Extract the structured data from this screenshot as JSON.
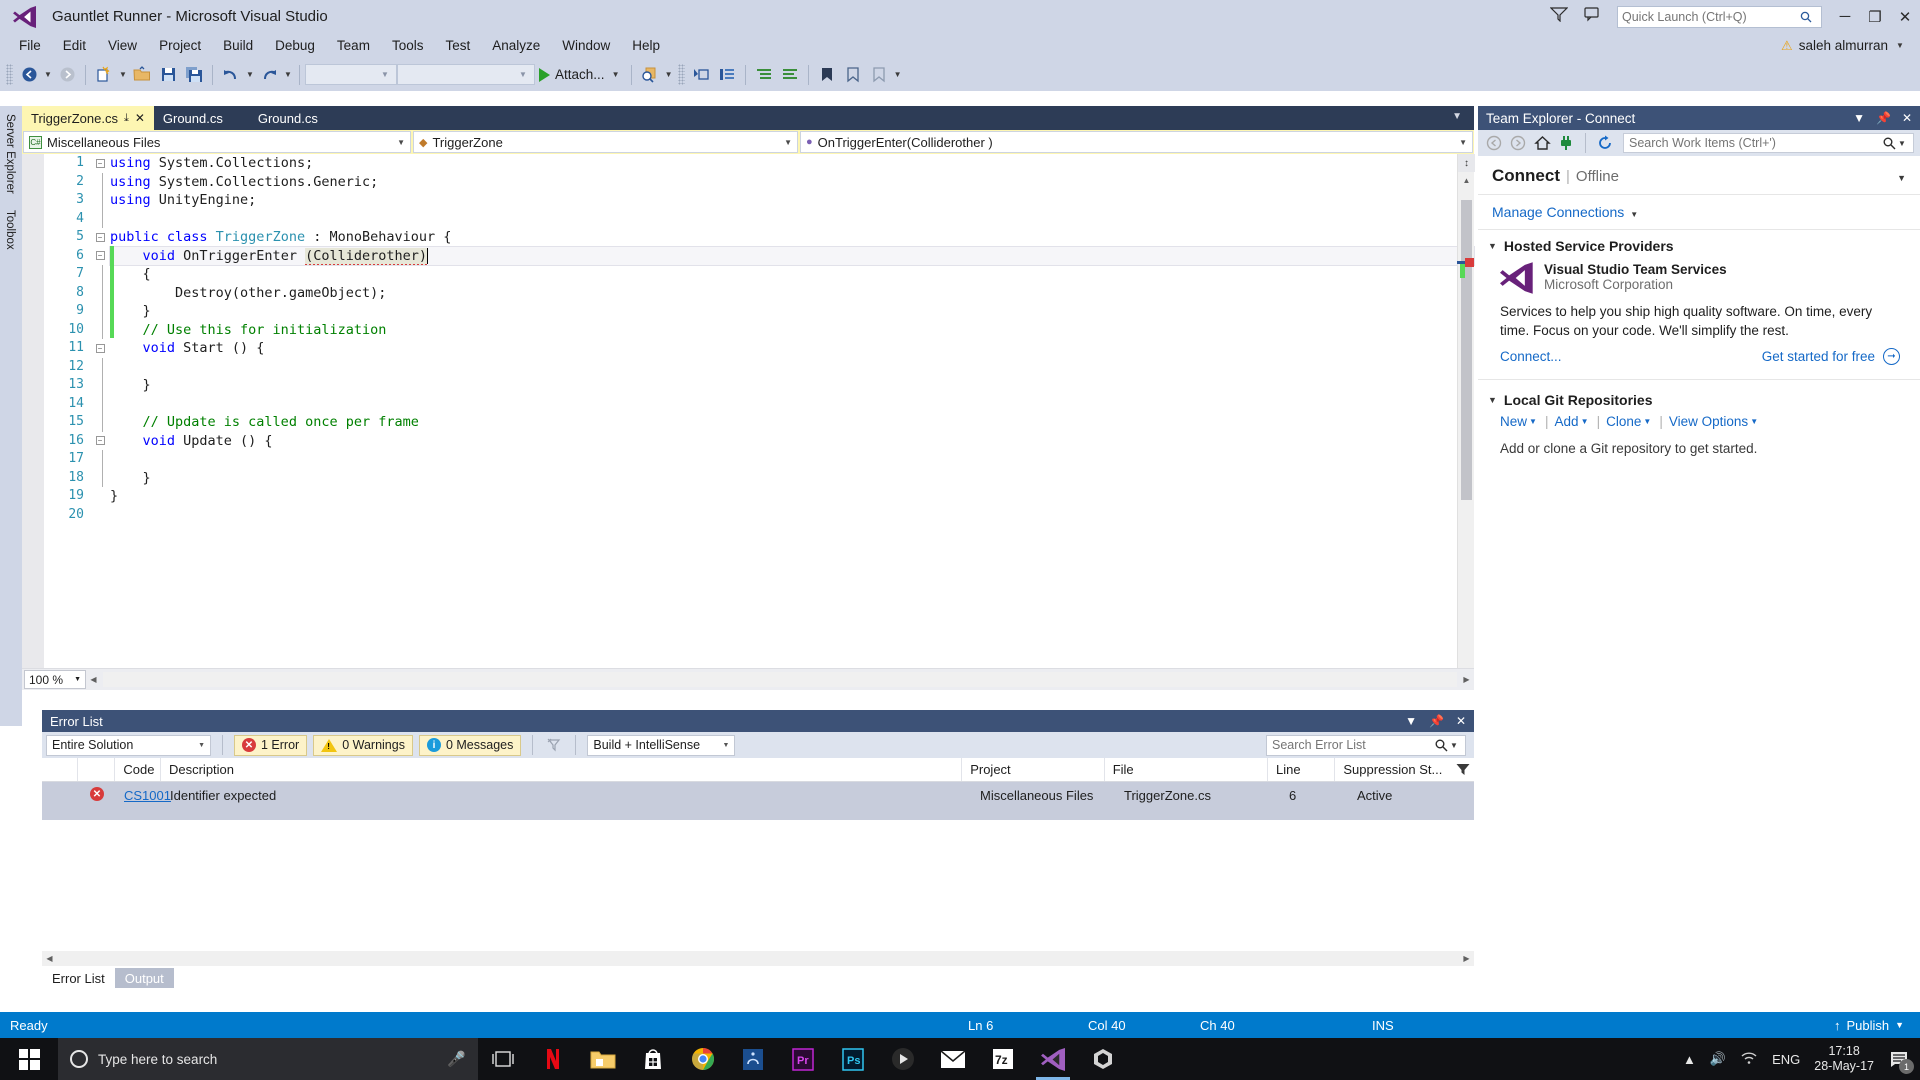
{
  "window": {
    "title": "Gauntlet Runner - Microsoft Visual Studio",
    "quick_launch_placeholder": "Quick Launch (Ctrl+Q)",
    "user_name": "saleh almurran",
    "minimize": "─",
    "maximize": "❐",
    "close": "✕"
  },
  "menu": {
    "items": [
      "File",
      "Edit",
      "View",
      "Project",
      "Build",
      "Debug",
      "Team",
      "Tools",
      "Test",
      "Analyze",
      "Window",
      "Help"
    ]
  },
  "toolbar": {
    "attach_label": "Attach...",
    "icons": [
      "navigate-back-icon",
      "navigate-forward-icon",
      "new-project-icon",
      "open-file-icon",
      "save-icon",
      "save-all-icon",
      "undo-icon",
      "redo-icon",
      "start-debug-icon",
      "find-icon",
      "step-icon",
      "comment-icon",
      "uncomment-icon",
      "bookmark-icon",
      "indent-icon",
      "outdent-icon"
    ]
  },
  "left_rail": {
    "items": [
      "Server Explorer",
      "Toolbox"
    ]
  },
  "editor": {
    "tabs": [
      {
        "label": "TriggerZone.cs",
        "active": true,
        "pin": "⤓",
        "close": "✕"
      },
      {
        "label": "Ground.cs",
        "active": false
      },
      {
        "label": "Ground.cs",
        "active": false
      }
    ],
    "nav": {
      "project": "Miscellaneous Files",
      "type": "TriggerZone",
      "member": "OnTriggerEnter(Colliderother )"
    },
    "zoom_level": "100 %",
    "line_numbers": [
      "1",
      "2",
      "3",
      "4",
      "5",
      "6",
      "7",
      "8",
      "9",
      "10",
      "11",
      "12",
      "13",
      "14",
      "15",
      "16",
      "17",
      "18",
      "19",
      "20"
    ],
    "code_lines": [
      {
        "n": 1,
        "indent": 0,
        "fold": "minus",
        "segments": [
          {
            "t": "using ",
            "c": "kw"
          },
          {
            "t": "System.Collections;",
            "c": ""
          }
        ]
      },
      {
        "n": 2,
        "indent": 0,
        "segments": [
          {
            "t": "using ",
            "c": "kw"
          },
          {
            "t": "System.Collections.Generic;",
            "c": ""
          }
        ]
      },
      {
        "n": 3,
        "indent": 0,
        "segments": [
          {
            "t": "using ",
            "c": "kw"
          },
          {
            "t": "UnityEngine;",
            "c": ""
          }
        ]
      },
      {
        "n": 4,
        "indent": 0,
        "segments": []
      },
      {
        "n": 5,
        "indent": 0,
        "fold": "minus",
        "segments": [
          {
            "t": "public class ",
            "c": "kw"
          },
          {
            "t": "TriggerZone",
            "c": "ty"
          },
          {
            "t": " : ",
            "c": ""
          },
          {
            "t": "MonoBehaviour",
            "c": ""
          },
          {
            "t": " {",
            "c": ""
          }
        ]
      },
      {
        "n": 6,
        "indent": 1,
        "fold": "minus",
        "highlight": true,
        "segments": [
          {
            "t": "void ",
            "c": "kw"
          },
          {
            "t": "OnTriggerEnter ",
            "c": ""
          },
          {
            "t": "(Colliderother)",
            "c": "param"
          }
        ]
      },
      {
        "n": 7,
        "indent": 1,
        "segments": [
          {
            "t": "{",
            "c": ""
          }
        ]
      },
      {
        "n": 8,
        "indent": 2,
        "segments": [
          {
            "t": "Destroy(other.gameObject);",
            "c": ""
          }
        ]
      },
      {
        "n": 9,
        "indent": 1,
        "segments": [
          {
            "t": "}",
            "c": ""
          }
        ]
      },
      {
        "n": 10,
        "indent": 1,
        "segments": [
          {
            "t": "// Use this for initialization",
            "c": "cm"
          }
        ]
      },
      {
        "n": 11,
        "indent": 1,
        "fold": "minus",
        "segments": [
          {
            "t": "void ",
            "c": "kw"
          },
          {
            "t": "Start () {",
            "c": ""
          }
        ]
      },
      {
        "n": 12,
        "indent": 1,
        "segments": []
      },
      {
        "n": 13,
        "indent": 1,
        "segments": [
          {
            "t": "}",
            "c": ""
          }
        ]
      },
      {
        "n": 14,
        "indent": 1,
        "segments": []
      },
      {
        "n": 15,
        "indent": 1,
        "segments": [
          {
            "t": "// Update is called once per frame",
            "c": "cm"
          }
        ]
      },
      {
        "n": 16,
        "indent": 1,
        "fold": "minus",
        "segments": [
          {
            "t": "void ",
            "c": "kw"
          },
          {
            "t": "Update () {",
            "c": ""
          }
        ]
      },
      {
        "n": 17,
        "indent": 1,
        "segments": []
      },
      {
        "n": 18,
        "indent": 1,
        "segments": [
          {
            "t": "}",
            "c": ""
          }
        ]
      },
      {
        "n": 19,
        "indent": 0,
        "segments": [
          {
            "t": "}",
            "c": ""
          }
        ]
      },
      {
        "n": 20,
        "indent": 0,
        "segments": []
      }
    ]
  },
  "team_explorer": {
    "title": "Team Explorer - Connect",
    "search_placeholder": "Search Work Items (Ctrl+')",
    "connect_label": "Connect",
    "status": "Offline",
    "manage_connections": "Manage Connections",
    "hosted_header": "Hosted Service Providers",
    "provider_name": "Visual Studio Team Services",
    "provider_company": "Microsoft Corporation",
    "provider_desc": "Services to help you ship high quality software. On time, every time. Focus on your code. We'll simplify the rest.",
    "connect_link": "Connect...",
    "get_started": "Get started for free",
    "git_header": "Local Git Repositories",
    "git_links": [
      "New",
      "Add",
      "Clone",
      "View Options"
    ],
    "git_note": "Add or clone a Git repository to get started."
  },
  "error_list": {
    "title": "Error List",
    "scope": "Entire Solution",
    "chips": [
      {
        "label": "1 Error",
        "icon": "error-icon"
      },
      {
        "label": "0 Warnings",
        "icon": "warning-icon"
      },
      {
        "label": "0 Messages",
        "icon": "info-icon"
      }
    ],
    "build_filter": "Build + IntelliSense",
    "search_placeholder": "Search Error List",
    "columns": [
      "",
      "",
      "Code",
      "Description",
      "Project",
      "File",
      "Line",
      "Suppression St..."
    ],
    "rows": [
      {
        "severity": "error-icon",
        "code": "CS1001",
        "description": "Identifier expected",
        "project": "Miscellaneous Files",
        "file": "TriggerZone.cs",
        "line": "6",
        "suppression": "Active"
      }
    ]
  },
  "bottom_tabs": [
    {
      "label": "Error List",
      "active": true
    },
    {
      "label": "Output",
      "active": false
    }
  ],
  "status_bar": {
    "ready": "Ready",
    "ln": "Ln 6",
    "col": "Col 40",
    "ch": "Ch 40",
    "ins": "INS",
    "publish": "Publish"
  },
  "taskbar": {
    "search_placeholder": "Type here to search",
    "language": "ENG",
    "time": "17:18",
    "date": "28-May-17",
    "notification_count": "1",
    "apps": [
      "task-view-icon",
      "netflix-icon",
      "file-explorer-icon",
      "microsoft-store-icon",
      "chrome-icon",
      "ps4-remote-icon",
      "premiere-pro-icon",
      "photoshop-icon",
      "media-player-icon",
      "mail-icon",
      "7zip-icon",
      "visual-studio-icon",
      "unity-icon"
    ]
  },
  "colors": {
    "accent": "#007acc",
    "chrome": "#cfd6e6",
    "panel_header": "#3d5277",
    "active_tab": "#fdf6b2",
    "error": "#d83b3b",
    "link": "#1569c7"
  }
}
